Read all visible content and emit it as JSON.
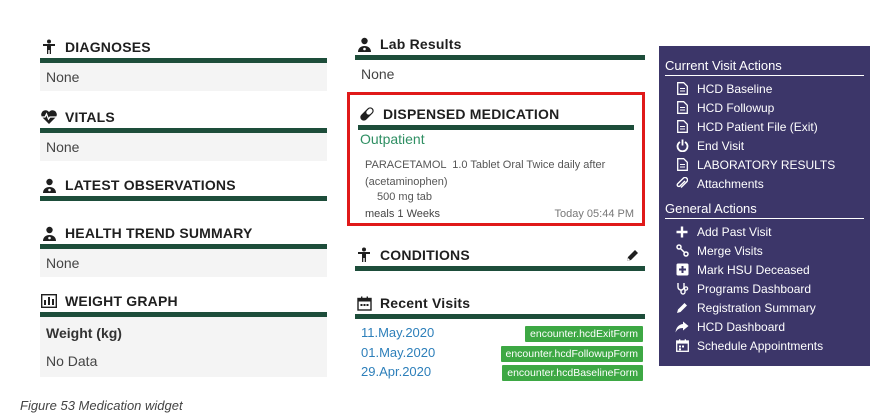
{
  "left_column": {
    "diagnoses": {
      "title": "DIAGNOSES",
      "value": "None"
    },
    "vitals": {
      "title": "VITALS",
      "value": "None"
    },
    "latest_observations": {
      "title": "LATEST OBSERVATIONS"
    },
    "health_trend": {
      "title": "HEALTH TREND SUMMARY",
      "value": "None"
    },
    "weight_graph": {
      "title": "WEIGHT GRAPH",
      "label": "Weight (kg)",
      "value": "No Data"
    }
  },
  "middle_column": {
    "lab_results": {
      "title": "Lab Results",
      "value": "None"
    },
    "dispensed_medication": {
      "title": "DISPENSED MEDICATION",
      "subtitle": "Outpatient",
      "drug_name": "PARACETAMOL",
      "dosage": "1.0 Tablet Oral Twice daily after",
      "generic": "(acetaminophen)",
      "strength": "500 mg tab",
      "duration": "meals 1 Weeks",
      "time": "Today 05:44 PM"
    },
    "conditions": {
      "title": "CONDITIONS"
    },
    "recent_visits": {
      "title": "Recent Visits",
      "items": [
        {
          "date": "11.May.2020",
          "form": "encounter.hcdExitForm"
        },
        {
          "date": "01.May.2020",
          "form": "encounter.hcdFollowupForm"
        },
        {
          "date": "29.Apr.2020",
          "form": "encounter.hcdBaselineForm"
        }
      ]
    }
  },
  "right_panel": {
    "current_title": "Current Visit Actions",
    "current_actions": [
      {
        "label": "HCD Baseline",
        "icon": "file-icon"
      },
      {
        "label": "HCD Followup",
        "icon": "file-icon"
      },
      {
        "label": "HCD Patient File (Exit)",
        "icon": "file-icon"
      },
      {
        "label": "End Visit",
        "icon": "power-icon"
      },
      {
        "label": "LABORATORY RESULTS",
        "icon": "file-icon"
      },
      {
        "label": "Attachments",
        "icon": "paperclip-icon"
      }
    ],
    "general_title": "General Actions",
    "general_actions": [
      {
        "label": "Add Past Visit",
        "icon": "plus-icon"
      },
      {
        "label": "Merge Visits",
        "icon": "merge-icon"
      },
      {
        "label": "Mark HSU Deceased",
        "icon": "plus-square-icon"
      },
      {
        "label": "Programs Dashboard",
        "icon": "stethoscope-icon"
      },
      {
        "label": "Registration Summary",
        "icon": "pencil-icon"
      },
      {
        "label": "HCD Dashboard",
        "icon": "share-icon"
      },
      {
        "label": "Schedule Appointments",
        "icon": "calendar-icon"
      }
    ]
  },
  "caption": "Figure 53 Medication widget",
  "colors": {
    "header_rule": "#1d4d3a",
    "panel_bg": "#3c3669",
    "highlight": "#e01919",
    "badge": "#3da844",
    "link": "#2d7fba"
  }
}
